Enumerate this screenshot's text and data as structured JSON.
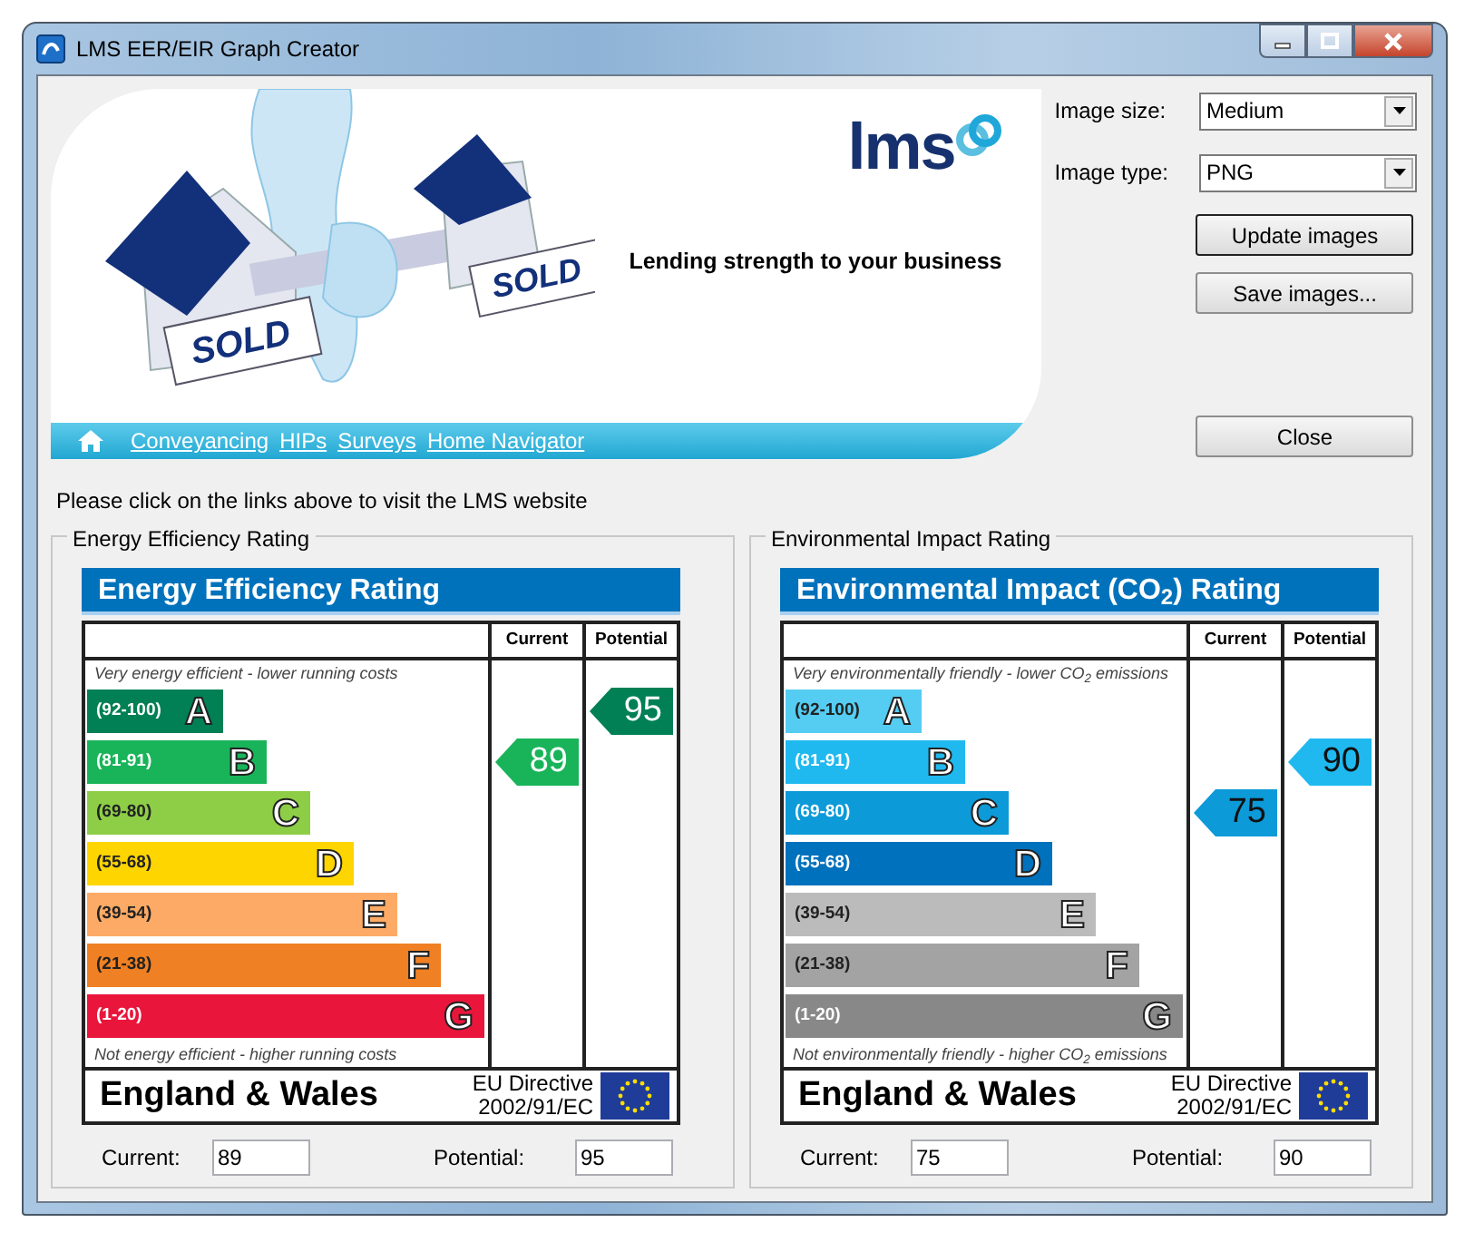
{
  "window": {
    "title": "LMS EER/EIR Graph Creator"
  },
  "banner": {
    "sold_signs": [
      "SOLD",
      "SOLD"
    ],
    "logo": "lms",
    "tagline": "Lending strength to your business",
    "links": [
      "Conveyancing",
      "HIPs",
      "Surveys",
      "Home Navigator"
    ]
  },
  "hint": "Please click on the links above to visit the LMS website",
  "options": {
    "fields": [
      {
        "label": "Image size:",
        "value": "Medium"
      },
      {
        "label": "Image type:",
        "value": "PNG"
      }
    ],
    "buttons": [
      {
        "label": "Update images",
        "default": true
      },
      {
        "label": "Save images...",
        "default": false
      }
    ],
    "close": "Close"
  },
  "ratings": [
    {
      "group_title": "Energy Efficiency Rating",
      "chart_title": "Energy Efficiency Rating",
      "columns": [
        "Current",
        "Potential"
      ],
      "top_note": "Very energy efficient - lower running costs",
      "bottom_note": "Not energy efficient - higher running costs",
      "bands": [
        {
          "range": "(92-100)",
          "letter": "A",
          "color": "#008054",
          "current_here": false,
          "potential_here": true
        },
        {
          "range": "(81-91)",
          "letter": "B",
          "color": "#19b459",
          "current_here": true,
          "potential_here": false
        },
        {
          "range": "(69-80)",
          "letter": "C",
          "color": "#8dce46",
          "current_here": false,
          "potential_here": false
        },
        {
          "range": "(55-68)",
          "letter": "D",
          "color": "#ffd500",
          "current_here": false,
          "potential_here": false
        },
        {
          "range": "(39-54)",
          "letter": "E",
          "color": "#fcaa65",
          "current_here": false,
          "potential_here": false
        },
        {
          "range": "(21-38)",
          "letter": "F",
          "color": "#ef8023",
          "current_here": false,
          "potential_here": false
        },
        {
          "range": "(1-20)",
          "letter": "G",
          "color": "#e9153b",
          "current_here": false,
          "potential_here": false
        }
      ],
      "current": "89",
      "potential": "95",
      "region": "England & Wales",
      "directive": [
        "EU Directive",
        "2002/91/EC"
      ],
      "fields": [
        {
          "label": "Current:",
          "value": "89"
        },
        {
          "label": "Potential:",
          "value": "95"
        }
      ]
    },
    {
      "group_title": "Environmental Impact Rating",
      "chart_title": "Environmental Impact (CO$_{2}$) Rating",
      "columns": [
        "Current",
        "Potential"
      ],
      "top_note": "Very environmentally friendly - lower CO$_{2}$ emissions",
      "bottom_note": "Not environmentally friendly - higher CO$_{2}$ emissions",
      "bands": [
        {
          "range": "(92-100)",
          "letter": "A",
          "color": "#55ccf1",
          "current_here": false,
          "potential_here": false
        },
        {
          "range": "(81-91)",
          "letter": "B",
          "color": "#1fb9ef",
          "current_here": false,
          "potential_here": true
        },
        {
          "range": "(69-80)",
          "letter": "C",
          "color": "#0c9ad8",
          "current_here": true,
          "potential_here": false
        },
        {
          "range": "(55-68)",
          "letter": "D",
          "color": "#0071bc",
          "current_here": false,
          "potential_here": false
        },
        {
          "range": "(39-54)",
          "letter": "E",
          "color": "#bbbbbb",
          "current_here": false,
          "potential_here": false
        },
        {
          "range": "(21-38)",
          "letter": "F",
          "color": "#a3a3a3",
          "current_here": false,
          "potential_here": false
        },
        {
          "range": "(1-20)",
          "letter": "G",
          "color": "#888888",
          "current_here": false,
          "potential_here": false
        }
      ],
      "current": "75",
      "potential": "90",
      "region": "England & Wales",
      "directive": [
        "EU Directive",
        "2002/91/EC"
      ],
      "fields": [
        {
          "label": "Current:",
          "value": "75"
        },
        {
          "label": "Potential:",
          "value": "90"
        }
      ]
    }
  ]
}
